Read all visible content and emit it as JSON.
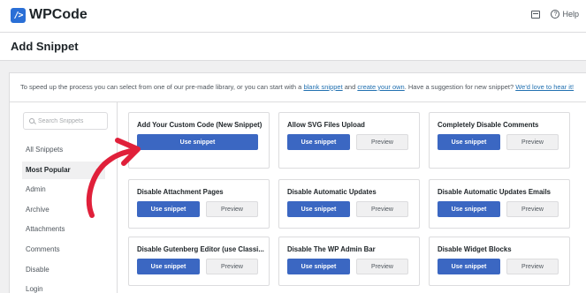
{
  "app": {
    "logo_mark": "/>",
    "name": "WPCode",
    "help_label": "Help",
    "icons": {
      "inbox": "inbox-icon",
      "help": "help-icon"
    }
  },
  "page": {
    "title": "Add Snippet"
  },
  "intro": {
    "text_before": "To speed up the process you can select from one of our pre-made library, or you can start with a ",
    "blank_link": "blank snippet",
    "and": " and ",
    "create_link": "create your own",
    "text_after": ". Have a suggestion for new snippet? ",
    "suggest_link": "We'd love to hear it!"
  },
  "sidebar": {
    "search_placeholder": "Search Snippets",
    "categories": [
      {
        "label": "All Snippets",
        "active": false
      },
      {
        "label": "Most Popular",
        "active": true
      },
      {
        "label": "Admin",
        "active": false
      },
      {
        "label": "Archive",
        "active": false
      },
      {
        "label": "Attachments",
        "active": false
      },
      {
        "label": "Comments",
        "active": false
      },
      {
        "label": "Disable",
        "active": false
      },
      {
        "label": "Login",
        "active": false
      }
    ]
  },
  "buttons": {
    "use": "Use snippet",
    "preview": "Preview"
  },
  "snippets": [
    {
      "title": "Add Your Custom Code (New Snippet)",
      "has_preview": false
    },
    {
      "title": "Allow SVG Files Upload",
      "has_preview": true
    },
    {
      "title": "Completely Disable Comments",
      "has_preview": true
    },
    {
      "title": "Disable Attachment Pages",
      "has_preview": true
    },
    {
      "title": "Disable Automatic Updates",
      "has_preview": true
    },
    {
      "title": "Disable Automatic Updates Emails",
      "has_preview": true
    },
    {
      "title": "Disable Gutenberg Editor (use Classi...",
      "has_preview": true
    },
    {
      "title": "Disable The WP Admin Bar",
      "has_preview": true
    },
    {
      "title": "Disable Widget Blocks",
      "has_preview": true
    }
  ],
  "colors": {
    "accent": "#3b67c2",
    "annotation_arrow": "#e0203a"
  }
}
